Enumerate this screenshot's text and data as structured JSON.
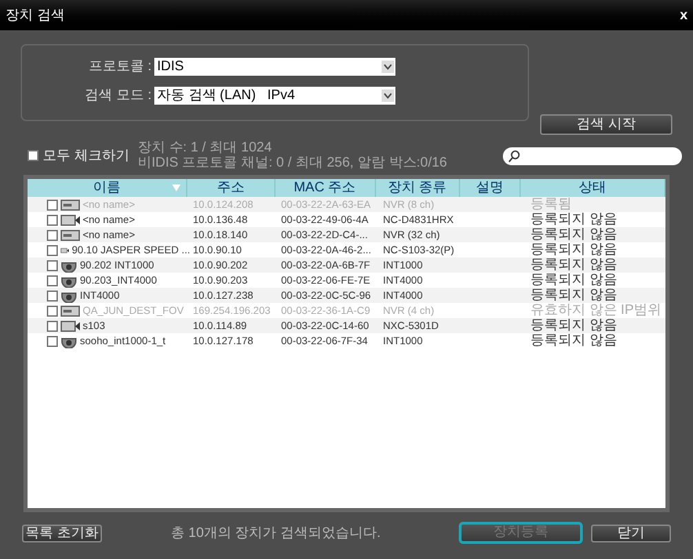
{
  "window": {
    "title": "장치 검색",
    "close": "x"
  },
  "form": {
    "protocol_label": "프로토콜 :",
    "protocol_value": "IDIS",
    "mode_label": "검색 모드 :",
    "mode_value": "자동 검색 (LAN)   IPv4"
  },
  "search_start": "검색 시작",
  "check_all": {
    "label": "모두 체크하기",
    "checked": false
  },
  "counts": [
    "장치 수: 1 / 최대 1024",
    "비IDIS 프로토콜 채널: 0 / 최대 256, 알람 박스:0/16"
  ],
  "table": {
    "columns": [
      "이름",
      "주소",
      "MAC 주소",
      "장치 종류",
      "설명",
      "상태"
    ],
    "rows": [
      {
        "kind": "recorder",
        "checked": false,
        "disabled": true,
        "cells": [
          "<no name>",
          "10.0.124.208",
          "00-03-22-2A-63-EA",
          "NVR (8 ch)",
          "",
          "등록됨"
        ]
      },
      {
        "kind": "camera",
        "checked": false,
        "disabled": false,
        "cells": [
          "<no name>",
          "10.0.136.48",
          "00-03-22-49-06-4A",
          "NC-D4831HRX",
          "",
          "등록되지 않음"
        ]
      },
      {
        "kind": "recorder",
        "checked": false,
        "disabled": false,
        "cells": [
          "<no name>",
          "10.0.18.140",
          "00-03-22-2D-C4-...",
          "NVR (32 ch)",
          "",
          "등록되지 않음"
        ]
      },
      {
        "kind": "camera",
        "checked": false,
        "disabled": false,
        "cells": [
          "90.10 JASPER SPEED ...",
          "10.0.90.10",
          "00-03-22-0A-46-2...",
          "NC-S103-32(P)",
          "",
          "등록되지 않음"
        ]
      },
      {
        "kind": "dome",
        "checked": false,
        "disabled": false,
        "cells": [
          "90.202 INT1000",
          "10.0.90.202",
          "00-03-22-0A-6B-7F",
          "INT1000",
          "",
          "등록되지 않음"
        ]
      },
      {
        "kind": "dome",
        "checked": false,
        "disabled": false,
        "cells": [
          "90.203_INT4000",
          "10.0.90.203",
          "00-03-22-06-FE-7E",
          "INT4000",
          "",
          "등록되지 않음"
        ]
      },
      {
        "kind": "dome",
        "checked": false,
        "disabled": false,
        "cells": [
          "INT4000",
          "10.0.127.238",
          "00-03-22-0C-5C-96",
          "INT4000",
          "",
          "등록되지 않음"
        ]
      },
      {
        "kind": "recorder",
        "checked": false,
        "disabled": true,
        "cells": [
          "QA_JUN_DEST_FOV",
          "169.254.196.203",
          "00-03-22-36-1A-C9",
          "NVR (4 ch)",
          "",
          "유효하지 않은 IP범위"
        ]
      },
      {
        "kind": "camera",
        "checked": false,
        "disabled": false,
        "cells": [
          "s103",
          "10.0.114.89",
          "00-03-22-0C-14-60",
          "NXC-5301D",
          "",
          "등록되지 않음"
        ]
      },
      {
        "kind": "dome",
        "checked": false,
        "disabled": false,
        "cells": [
          "sooho_int1000-1_t",
          "10.0.127.178",
          "00-03-22-06-7F-34",
          "INT1000",
          "",
          "등록되지 않음"
        ]
      }
    ]
  },
  "footer": {
    "reset": "목록 초기화",
    "message": "총 10개의 장치가 검색되었습니다.",
    "register": {
      "label": "장치등록",
      "disabled": true
    },
    "close": "닫기"
  }
}
